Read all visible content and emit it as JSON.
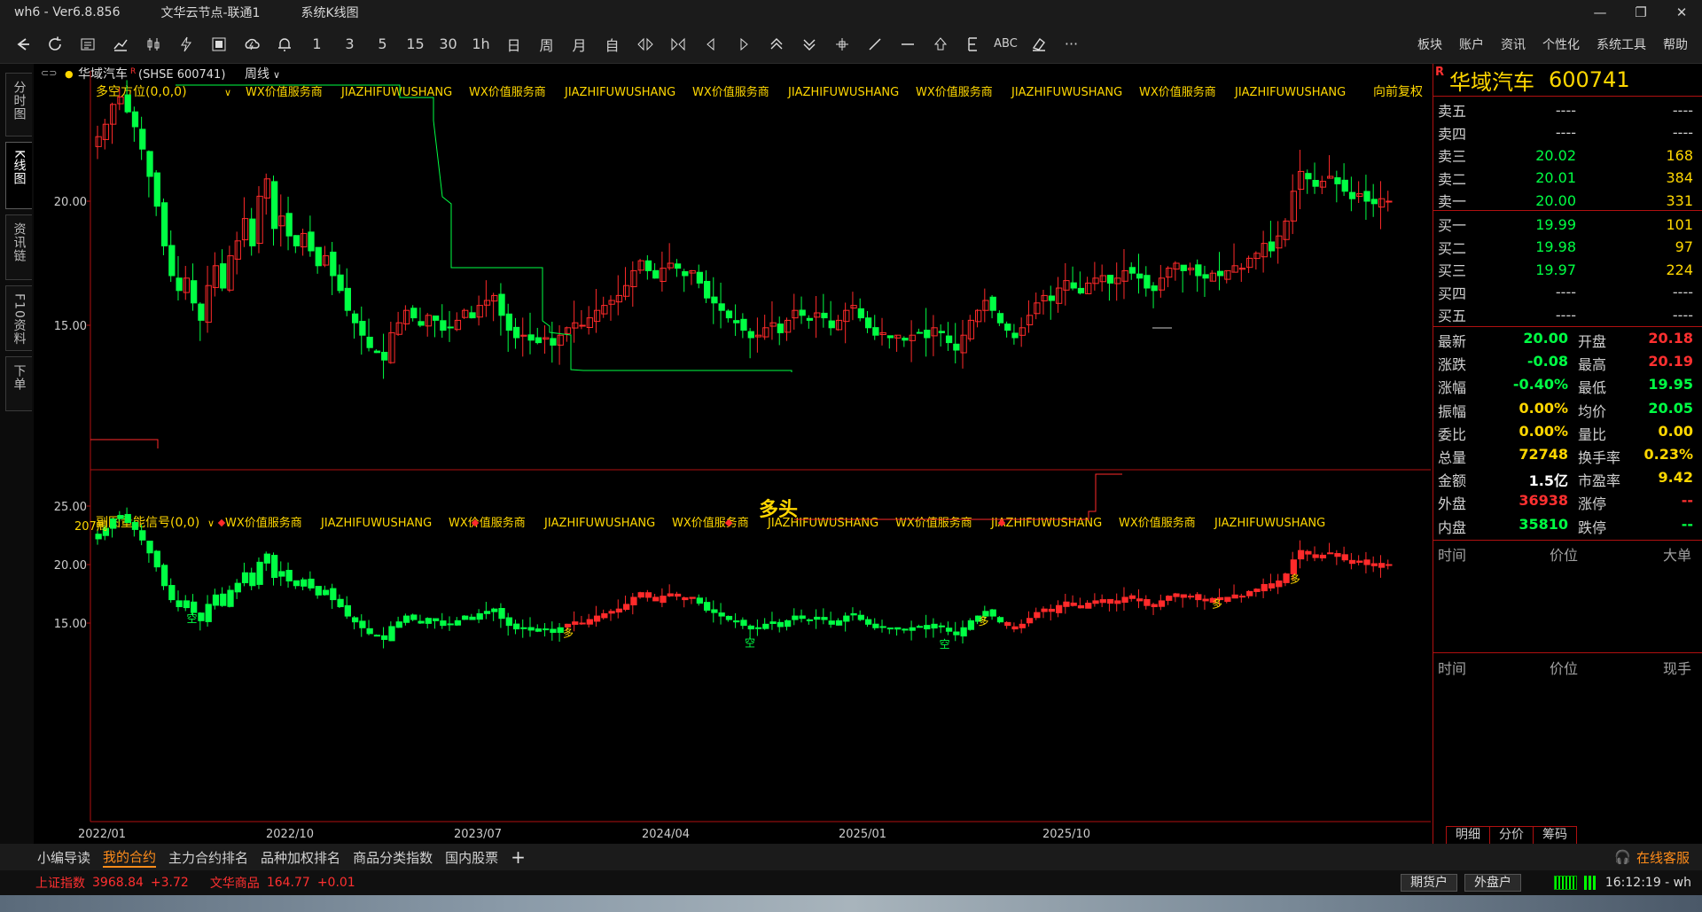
{
  "app": {
    "name": "wh6",
    "version": "Ver6.8.856",
    "server": "文华云节点-联通1",
    "window_title": "系统K线图"
  },
  "toolbar": {
    "buttons": [
      {
        "name": "back-icon",
        "label": ""
      },
      {
        "name": "refresh-icon",
        "label": ""
      },
      {
        "name": "list-icon",
        "label": ""
      },
      {
        "name": "line-chart-icon",
        "label": ""
      },
      {
        "name": "candle-icon",
        "label": ""
      },
      {
        "name": "lightning-icon",
        "label": ""
      },
      {
        "name": "scan-icon",
        "label": ""
      },
      {
        "name": "cloud-icon",
        "label": ""
      },
      {
        "name": "bell-icon",
        "label": ""
      },
      {
        "name": "period-1",
        "label": "1"
      },
      {
        "name": "period-3",
        "label": "3"
      },
      {
        "name": "period-5",
        "label": "5"
      },
      {
        "name": "period-15",
        "label": "15"
      },
      {
        "name": "period-30",
        "label": "30"
      },
      {
        "name": "period-1h",
        "label": "1h"
      },
      {
        "name": "period-day",
        "label": "日"
      },
      {
        "name": "period-week",
        "label": "周"
      },
      {
        "name": "period-month",
        "label": "月"
      },
      {
        "name": "period-custom",
        "label": "自"
      },
      {
        "name": "zoom-in-icon",
        "label": ""
      },
      {
        "name": "zoom-out-icon",
        "label": ""
      },
      {
        "name": "left-arrow-icon",
        "label": ""
      },
      {
        "name": "right-arrow-icon",
        "label": ""
      },
      {
        "name": "up-arrows-icon",
        "label": ""
      },
      {
        "name": "down-arrows-icon",
        "label": ""
      },
      {
        "name": "crosshair-icon",
        "label": ""
      },
      {
        "name": "draw-line-icon",
        "label": ""
      },
      {
        "name": "hline-icon",
        "label": ""
      },
      {
        "name": "up-icon",
        "label": ""
      },
      {
        "name": "fib-icon",
        "label": ""
      },
      {
        "name": "text-tool",
        "label": "ABC"
      },
      {
        "name": "eraser-icon",
        "label": ""
      },
      {
        "name": "more-icon",
        "label": "···"
      }
    ],
    "menu": [
      "板块",
      "账户",
      "资讯",
      "个性化",
      "系统工具",
      "帮助"
    ]
  },
  "left_tabs": [
    {
      "label": "分时图",
      "active": false
    },
    {
      "label": "K线图",
      "active": true
    },
    {
      "label": "资讯链",
      "active": false
    },
    {
      "label": "F10资料",
      "active": false
    },
    {
      "label": "下单",
      "active": false
    }
  ],
  "chart_header": {
    "symbol_name": "华域汽车",
    "symbol_badge": "R",
    "symbol_code": "(SHSE 600741)",
    "period": "周线",
    "adjust": "向前复权"
  },
  "colors": {
    "up": "#ff2a2a",
    "down": "#00ff44",
    "accent": "#ffd700",
    "frame": "#b01010"
  },
  "main_panel": {
    "indicator": "多空方位(0,0,0)",
    "watermarks": [
      "WX价值服务商",
      "JIAZHIFUWUSHANG",
      "WX价值服务商",
      "JIAZHIFUWUSHANG",
      "WX价值服务商",
      "JIAZHIFUWUSHANG",
      "WX价值服务商",
      "JIAZHIFUWUSHANG",
      "WX价值服务商",
      "JIAZHIFUWUSHANG"
    ],
    "bars_label": "207周",
    "signal_text": "多头",
    "y_ticks": [
      "20.00",
      "15.00"
    ]
  },
  "sub_panel": {
    "indicator": "副图量能信号(0,0)",
    "watermarks": [
      "WX价值服务商",
      "JIAZHIFUWUSHANG",
      "WX价值服务商",
      "JIAZHIFUWUSHANG",
      "WX价值服务商",
      "JIAZHIFUWUSHANG",
      "WX价值服务商",
      "JIAZHIFUWUSHANG",
      "WX价值服务商",
      "JIAZHIFUWUSHANG"
    ],
    "y_ticks": [
      "25.00",
      "20.00",
      "15.00"
    ],
    "markers": [
      {
        "t": "空",
        "w": 0.07
      },
      {
        "t": "多",
        "w": 0.36
      },
      {
        "t": "空",
        "w": 0.5
      },
      {
        "t": "空",
        "w": 0.65
      },
      {
        "t": "多",
        "w": 0.68
      },
      {
        "t": "多",
        "w": 0.86
      },
      {
        "t": "多",
        "w": 0.92
      }
    ]
  },
  "x_axis": [
    "2022/01",
    "2022/10",
    "2023/07",
    "2024/04",
    "2025/01",
    "2025/10"
  ],
  "series_weekly_close": [
    22.6,
    23.1,
    23.9,
    24.2,
    23.6,
    23.0,
    22.1,
    21.0,
    19.8,
    18.2,
    17.0,
    16.4,
    16.9,
    15.9,
    15.2,
    16.6,
    17.4,
    16.5,
    17.8,
    18.4,
    19.3,
    18.2,
    20.2,
    20.9,
    18.9,
    19.4,
    18.6,
    18.2,
    18.7,
    18.0,
    17.4,
    17.8,
    17.0,
    16.4,
    15.6,
    15.1,
    14.6,
    14.1,
    13.9,
    13.6,
    14.7,
    15.1,
    15.6,
    15.3,
    15.0,
    15.4,
    15.2,
    14.8,
    14.9,
    15.2,
    15.6,
    15.3,
    15.8,
    16.0,
    16.2,
    15.4,
    14.8,
    14.5,
    14.6,
    14.4,
    14.3,
    14.5,
    14.2,
    14.6,
    14.9,
    15.1,
    15.0,
    15.3,
    15.6,
    15.8,
    16.0,
    16.2,
    16.6,
    17.2,
    17.6,
    17.2,
    16.9,
    17.3,
    17.5,
    17.3,
    17.0,
    17.2,
    16.7,
    16.1,
    15.9,
    15.6,
    15.3,
    15.1,
    14.8,
    14.5,
    14.6,
    14.9,
    15.1,
    14.7,
    15.2,
    15.6,
    15.4,
    15.2,
    15.5,
    15.3,
    14.9,
    15.2,
    15.6,
    15.8,
    15.3,
    14.9,
    14.6,
    14.7,
    14.5,
    14.6,
    14.4,
    14.6,
    14.7,
    14.5,
    14.9,
    14.7,
    14.3,
    14.0,
    14.6,
    15.2,
    15.6,
    16.0,
    15.6,
    15.1,
    14.8,
    14.5,
    14.9,
    15.4,
    15.9,
    16.2,
    16.0,
    16.5,
    16.8,
    16.5,
    16.3,
    16.7,
    16.9,
    17.0,
    16.7,
    16.9,
    17.2,
    17.1,
    16.9,
    16.5,
    16.4,
    16.9,
    17.3,
    17.5,
    17.2,
    17.3,
    17.0,
    16.9,
    17.1,
    17.0,
    17.2,
    17.4,
    17.3,
    17.7,
    17.9,
    18.3,
    18.0,
    18.6,
    19.2,
    20.4,
    21.2,
    20.9,
    20.6,
    20.8,
    21.0,
    20.7,
    20.4,
    20.1,
    20.3,
    20.0,
    19.9,
    20.1,
    20.0
  ],
  "quote": {
    "name": "华域汽车",
    "badge": "R",
    "code": "600741",
    "asks": [
      {
        "label": "卖五",
        "price": "----",
        "vol": "----"
      },
      {
        "label": "卖四",
        "price": "----",
        "vol": "----"
      },
      {
        "label": "卖三",
        "price": "20.02",
        "vol": "168"
      },
      {
        "label": "卖二",
        "price": "20.01",
        "vol": "384"
      },
      {
        "label": "卖一",
        "price": "20.00",
        "vol": "331"
      }
    ],
    "bids": [
      {
        "label": "买一",
        "price": "19.99",
        "vol": "101"
      },
      {
        "label": "买二",
        "price": "19.98",
        "vol": "97"
      },
      {
        "label": "买三",
        "price": "19.97",
        "vol": "224"
      },
      {
        "label": "买四",
        "price": "----",
        "vol": "----"
      },
      {
        "label": "买五",
        "price": "----",
        "vol": "----"
      }
    ],
    "stats": [
      {
        "l": "最新",
        "v": "20.00",
        "vc": "#00ff44",
        "r": "开盘",
        "rv": "20.18",
        "rc": "#ff3030"
      },
      {
        "l": "涨跌",
        "v": "-0.08",
        "vc": "#00ff44",
        "r": "最高",
        "rv": "20.19",
        "rc": "#ff3030"
      },
      {
        "l": "涨幅",
        "v": "-0.40%",
        "vc": "#00ff44",
        "r": "最低",
        "rv": "19.95",
        "rc": "#00ff44"
      },
      {
        "l": "振幅",
        "v": "0.00%",
        "vc": "#ffd700",
        "r": "均价",
        "rv": "20.05",
        "rc": "#00ff44"
      },
      {
        "l": "委比",
        "v": "0.00%",
        "vc": "#ffd700",
        "r": "量比",
        "rv": "0.00",
        "rc": "#ffd700"
      },
      {
        "l": "总量",
        "v": "72748",
        "vc": "#ffd700",
        "r": "换手率",
        "rv": "0.23%",
        "rc": "#ffd700"
      },
      {
        "l": "金额",
        "v": "1.5亿",
        "vc": "#ffffff",
        "r": "市盈率",
        "rv": "9.42",
        "rc": "#ffd700"
      },
      {
        "l": "外盘",
        "v": "36938",
        "vc": "#ff3030",
        "r": "涨停",
        "rv": "--",
        "rc": "#ff3030"
      },
      {
        "l": "内盘",
        "v": "35810",
        "vc": "#00ff44",
        "r": "跌停",
        "rv": "--",
        "rc": "#00ff44"
      }
    ],
    "tick_head1": {
      "time": "时间",
      "price": "价位",
      "vol": "大单"
    },
    "tick_head2": {
      "time": "时间",
      "price": "价位",
      "vol": "现手"
    },
    "tabs": [
      "明细",
      "分价",
      "筹码"
    ]
  },
  "bottom_tabs": {
    "items": [
      "小编导读",
      "我的合约",
      "主力合约排名",
      "品种加权排名",
      "商品分类指数",
      "国内股票"
    ],
    "active": 1,
    "plus": "+",
    "service": "在线客服"
  },
  "status": {
    "idx1_name": "上证指数",
    "idx1_val": "3968.84",
    "idx1_chg": "+3.72",
    "idx2_name": "文华商品",
    "idx2_val": "164.77",
    "idx2_chg": "+0.01",
    "acct1": "期货户",
    "acct2": "外盘户",
    "clock": "16:12:19 - wh"
  }
}
